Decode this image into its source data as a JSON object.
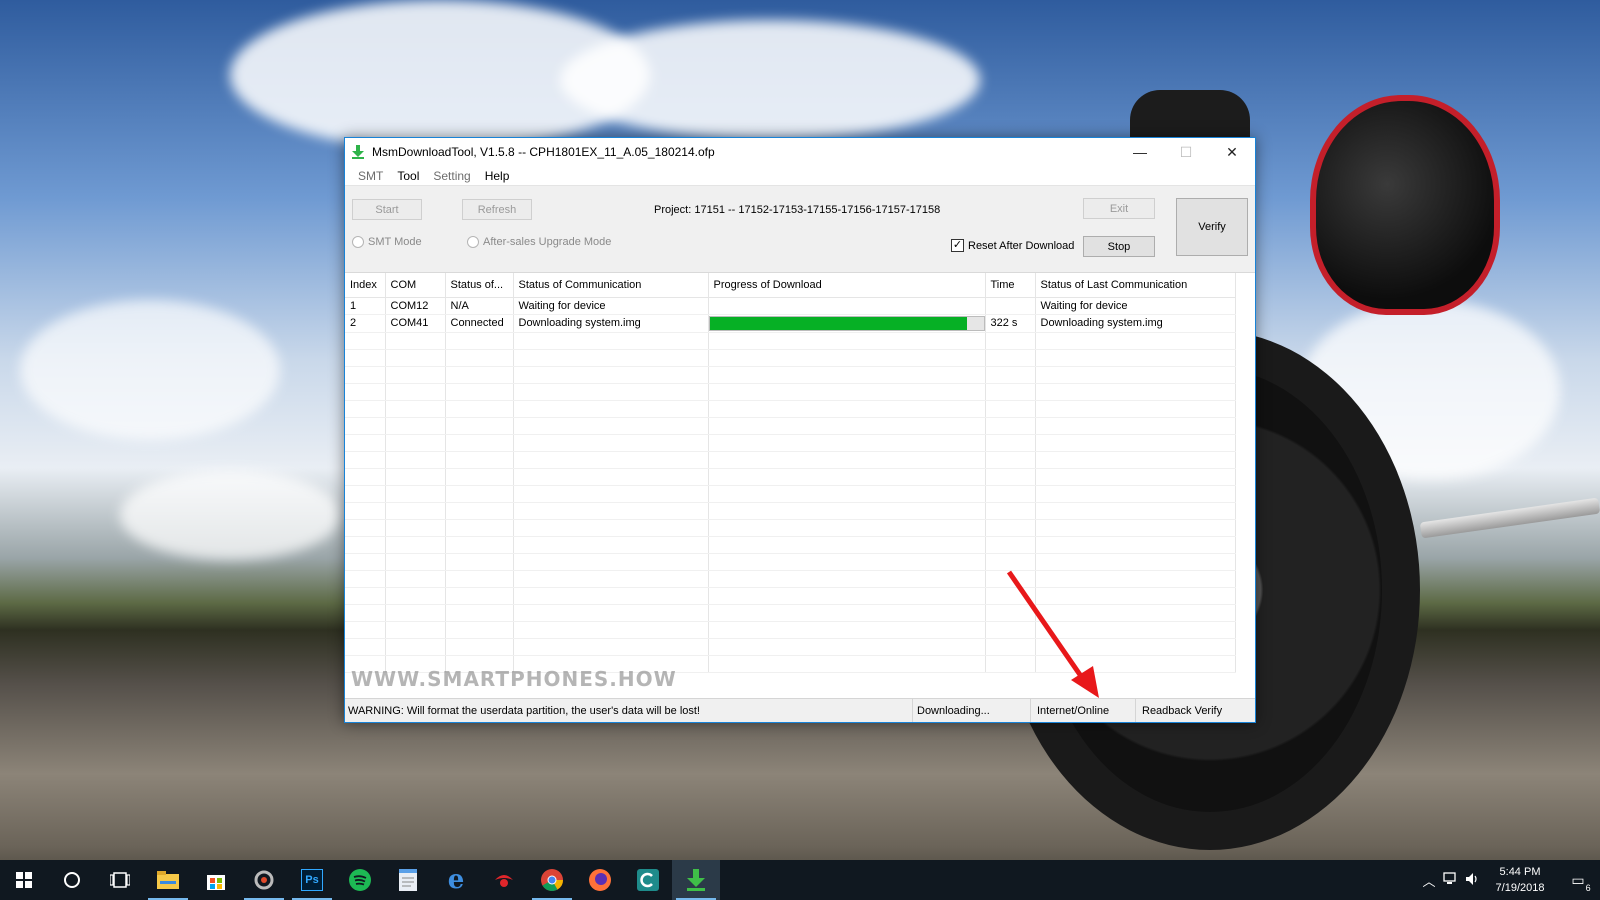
{
  "window": {
    "title": "MsmDownloadTool, V1.5.8 -- CPH1801EX_11_A.05_180214.ofp",
    "controls": {
      "minimize": "—",
      "maximize": "☐",
      "close": "✕"
    }
  },
  "menu": {
    "items": [
      {
        "label": "SMT",
        "enabled": false
      },
      {
        "label": "Tool",
        "enabled": true
      },
      {
        "label": "Setting",
        "enabled": false
      },
      {
        "label": "Help",
        "enabled": true
      }
    ]
  },
  "toolbar": {
    "start_label": "Start",
    "refresh_label": "Refresh",
    "project_text": "Project: 17151 -- 17152-17153-17155-17156-17157-17158",
    "exit_label": "Exit",
    "verify_label": "Verify",
    "stop_label": "Stop",
    "smt_mode_label": "SMT Mode",
    "after_sales_label": "After-sales Upgrade Mode",
    "reset_after_download_label": "Reset After Download",
    "reset_after_download_checked": true
  },
  "table": {
    "headers": [
      "Index",
      "COM",
      "Status of...",
      "Status of Communication",
      "Progress of Download",
      "Time",
      "Status of Last Communication"
    ],
    "rows": [
      {
        "index": "1",
        "com": "COM12",
        "status": "N/A",
        "comm": "Waiting for device",
        "progress": null,
        "time": "",
        "last": "Waiting for device"
      },
      {
        "index": "2",
        "com": "COM41",
        "status": "Connected",
        "comm": "Downloading system.img",
        "progress": 0.94,
        "time": "322 s",
        "last": "Downloading system.img"
      }
    ]
  },
  "watermark": "WWW.SMARTPHONES.HOW",
  "statusbar": {
    "warning": "WARNING: Will format the userdata partition, the user's data will be lost!",
    "state": "Downloading...",
    "network": "Internet/Online",
    "mode": "Readback Verify"
  },
  "taskbar": {
    "icons": [
      "windows-start-icon",
      "cortana-search-icon",
      "task-view-icon",
      "file-explorer-icon",
      "store-icon",
      "davinci-icon",
      "photoshop-icon",
      "spotify-icon",
      "notepad-icon",
      "edge-icon",
      "antivirus-icon",
      "chrome-icon",
      "firefox-icon",
      "ccleaner-icon",
      "msm-download-icon"
    ],
    "ps_label": "Ps",
    "clock_time": "5:44 PM",
    "clock_date": "7/19/2018",
    "notification_count": "6"
  },
  "colors": {
    "progress_fill": "#06b025",
    "window_border": "#1883d7",
    "arrow": "#e8181a"
  }
}
